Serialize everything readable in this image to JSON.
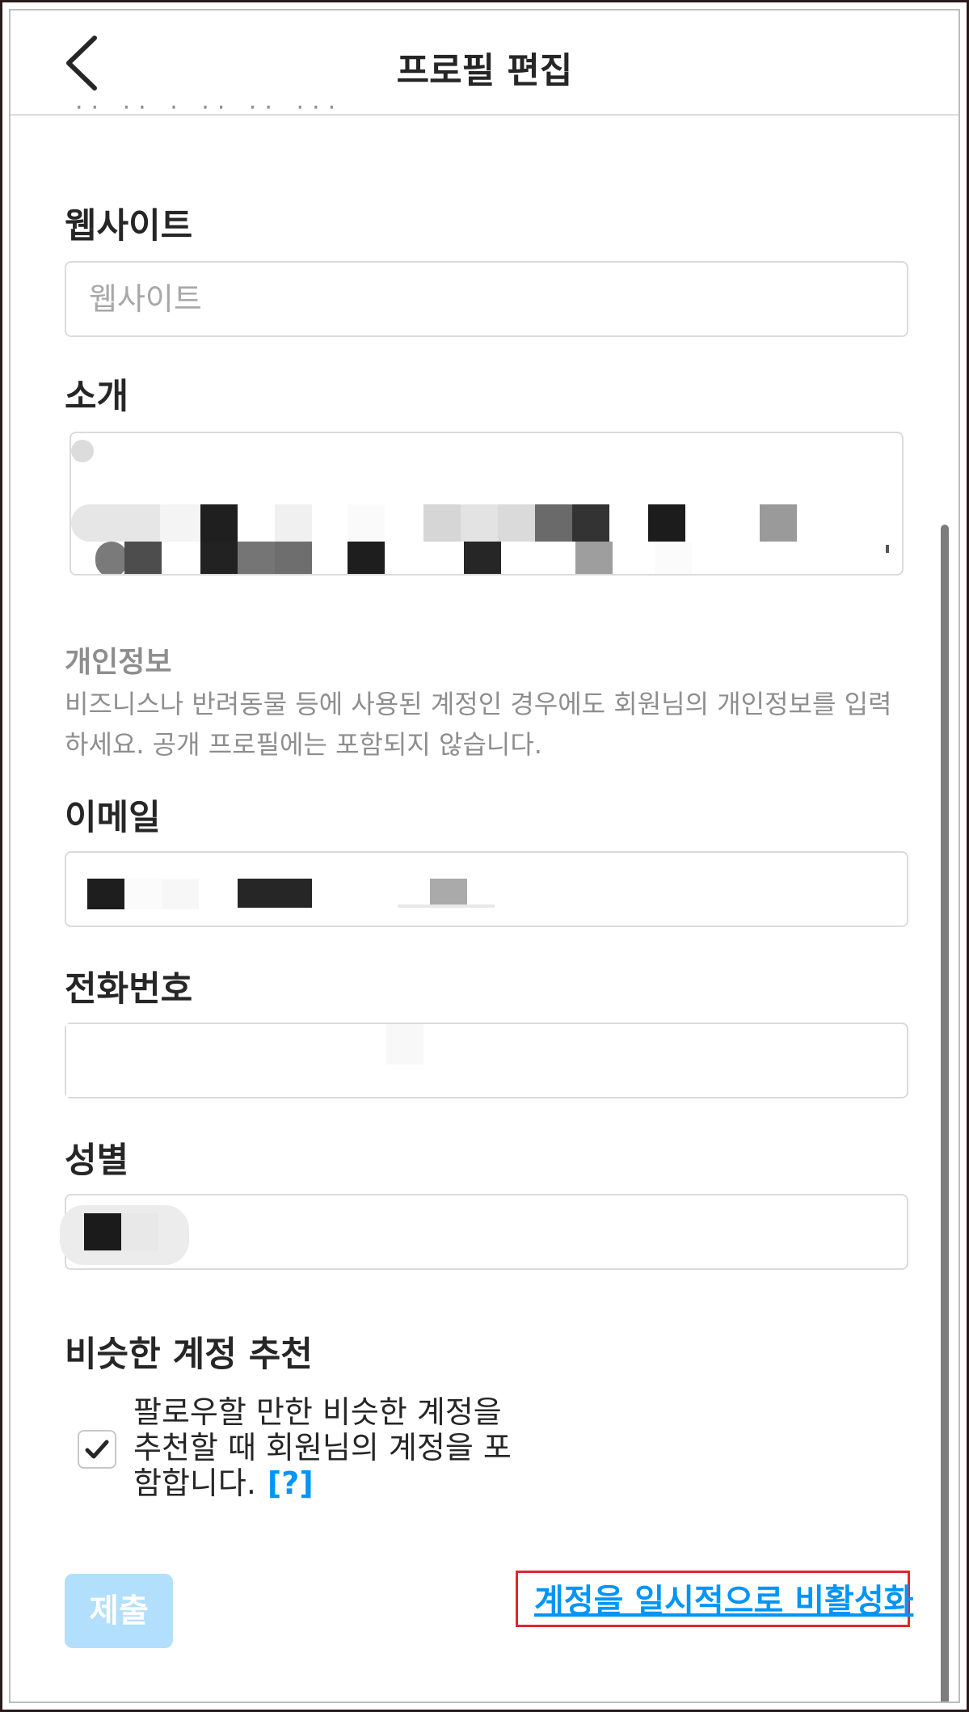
{
  "header": {
    "title": "프로필 편집"
  },
  "fields": {
    "website": {
      "label": "웹사이트",
      "placeholder": "웹사이트",
      "value": ""
    },
    "bio": {
      "label": "소개"
    },
    "email": {
      "label": "이메일"
    },
    "phone": {
      "label": "전화번호"
    },
    "gender": {
      "label": "성별"
    }
  },
  "personal_info": {
    "title": "개인정보",
    "description": "비즈니스나 반려동물 등에 사용된 계정인 경우에도 회원님의 개인정보를 입력하세요. 공개 프로필에는 포함되지 않습니다."
  },
  "suggestions": {
    "title": "비슷한 계정 추천",
    "checkbox_text": "팔로우할 만한 비슷한 계정을 추천할 때 회원님의 계정을 포함합니다.",
    "checked": true,
    "help_link": "[?]"
  },
  "actions": {
    "submit_label": "제출",
    "deactivate_label": "계정을 일시적으로 비활성화"
  },
  "colors": {
    "link": "#0095f6",
    "submit_disabled": "#b2dffc",
    "highlight_box": "#e3262b",
    "border": "#dbdbdb"
  },
  "icons": {
    "back": "chevron-left-icon",
    "check": "checkmark-icon"
  }
}
